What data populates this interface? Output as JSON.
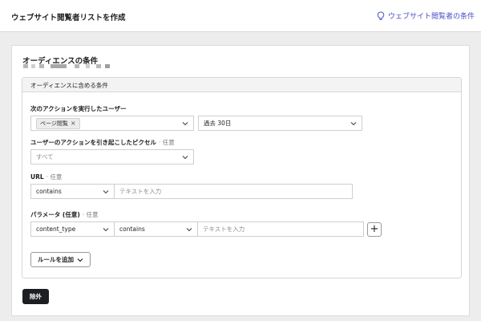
{
  "header": {
    "title": "ウェブサイト閲覧者リストを作成",
    "link_label": "ウェブサイト閲覧者の条件"
  },
  "card": {
    "title": "オーディエンスの条件"
  },
  "include_section": {
    "title": "オーディエンスに含める条件",
    "action": {
      "label": "次のアクションを実行したユーザー",
      "selected_chip": "ページ閲覧",
      "time_range": "過去 30日"
    },
    "pixel": {
      "label": "ユーザーのアクションを引き起こしたピクセル",
      "optional": "· 任意",
      "value": "すべて"
    },
    "url": {
      "label": "URL",
      "optional": "· 任意",
      "operator": "contains",
      "placeholder": "テキストを入力"
    },
    "parameter": {
      "label": "パラメータ (任意)",
      "optional": "· 任意",
      "key": "content_type",
      "operator": "contains",
      "placeholder": "テキストを入力",
      "add_symbol": "+"
    },
    "add_rule_label": "ルールを追加"
  },
  "exclude_label": "除外",
  "colors": {
    "accent": "#4a4fc4",
    "dark_button": "#1c1e21",
    "page_background": "#ededed"
  },
  "icons": [
    "lightbulb-icon",
    "chevron-down-icon",
    "close-icon",
    "plus-icon"
  ]
}
